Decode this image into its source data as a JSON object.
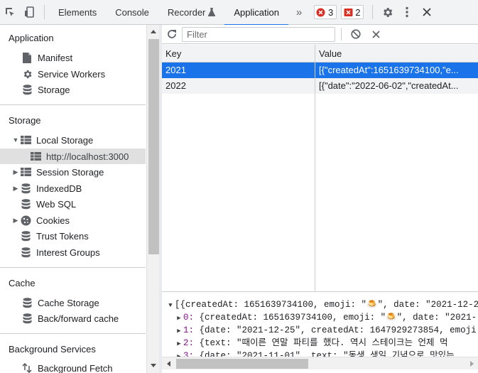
{
  "toolbar": {
    "tabs": [
      {
        "label": "Elements"
      },
      {
        "label": "Console"
      },
      {
        "label": "Recorder"
      },
      {
        "label": "Application",
        "active": true
      }
    ],
    "error_count": "3",
    "issue_count": "2"
  },
  "sidebar": {
    "application": {
      "title": "Application",
      "items": [
        {
          "label": "Manifest",
          "icon": "file-icon"
        },
        {
          "label": "Service Workers",
          "icon": "gear-icon"
        },
        {
          "label": "Storage",
          "icon": "database-icon"
        }
      ]
    },
    "storage": {
      "title": "Storage",
      "items": [
        {
          "label": "Local Storage",
          "icon": "table-icon",
          "expanded": true
        },
        {
          "label": "http://localhost:3000",
          "icon": "table-icon",
          "selected": true
        },
        {
          "label": "Session Storage",
          "icon": "table-icon"
        },
        {
          "label": "IndexedDB",
          "icon": "database-icon"
        },
        {
          "label": "Web SQL",
          "icon": "database-icon"
        },
        {
          "label": "Cookies",
          "icon": "cookie-icon"
        },
        {
          "label": "Trust Tokens",
          "icon": "database-icon"
        },
        {
          "label": "Interest Groups",
          "icon": "database-icon"
        }
      ]
    },
    "cache": {
      "title": "Cache",
      "items": [
        {
          "label": "Cache Storage",
          "icon": "database-icon"
        },
        {
          "label": "Back/forward cache",
          "icon": "database-icon"
        }
      ]
    },
    "background": {
      "title": "Background Services",
      "items": [
        {
          "label": "Background Fetch",
          "icon": "sync-icon"
        }
      ]
    }
  },
  "filter": {
    "placeholder": "Filter"
  },
  "table": {
    "columns": [
      "Key",
      "Value"
    ],
    "rows": [
      {
        "key": "2021",
        "value": "[{\"createdAt\":1651639734100,\"e...",
        "selected": true
      },
      {
        "key": "2022",
        "value": "[{\"date\":\"2022-06-02\",\"createdAt..."
      }
    ]
  },
  "preview": {
    "root": "[{createdAt: 1651639734100, emoji: \"🍮\", date: \"2021-12-2",
    "items": [
      {
        "index": "0",
        "text": "{createdAt: 1651639734100, emoji: \"🍮\", date: \"2021-:"
      },
      {
        "index": "1",
        "text": "{date: \"2021-12-25\", createdAt: 1647929273854, emoji:"
      },
      {
        "index": "2",
        "text": "{text: \"때이른 연말 파티를 했다. 역시 스테이크는 언제 먹"
      },
      {
        "index": "3",
        "text": "{date: \"2021-11-01\", text: \"동생 생일 기념으로 맛있는"
      }
    ]
  }
}
